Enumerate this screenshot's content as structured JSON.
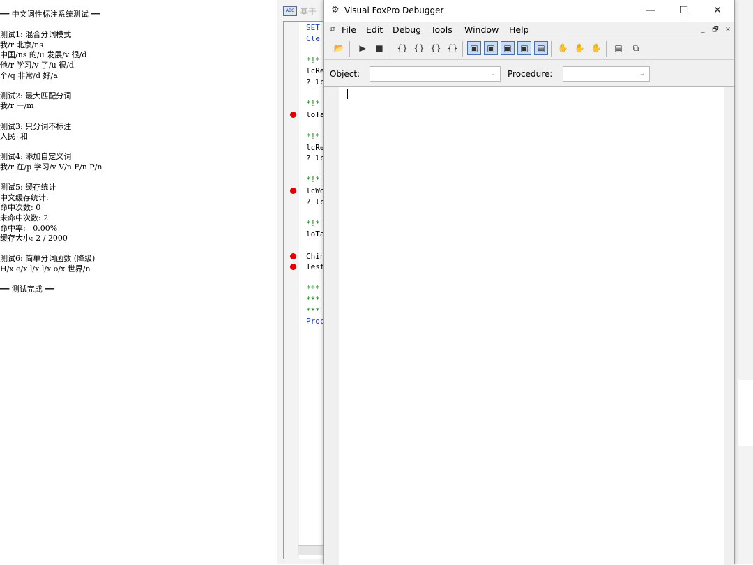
{
  "console": {
    "lines": [
      "══ 中文词性标注系统测试 ══",
      "",
      "测试1: 混合分词模式",
      "我/r 北京/ns",
      "中国/ns 的/u 发展/v 很/d",
      "他/r 学习/v 了/u 很/d",
      "个/q 非常/d 好/a",
      "",
      "测试2: 最大匹配分词",
      "我/r 一/m",
      "",
      "测试3: 只分词不标注",
      "人民  和",
      "",
      "测试4: 添加自定义词",
      "我/r 在/p 学习/v V/n F/n P/n",
      "",
      "测试5: 缓存统计",
      "中文缓存统计:",
      "命中次数: 0",
      "未命中次数: 2",
      "命中率:   0.00%",
      "缓存大小: 2 / 2000",
      "",
      "测试6: 简单分词函数 (降级)",
      "H/x e/x l/x l/x o/x 世界/n",
      "",
      "══ 测试完成 ══"
    ]
  },
  "editor": {
    "icon_text": "ABC",
    "title": "基于",
    "code_lines": [
      {
        "text": "SET",
        "color": "#1a3fbf",
        "bp": false
      },
      {
        "text": "Cle",
        "color": "#1a3fbf",
        "bp": false
      },
      {
        "text": "",
        "color": "#000000",
        "bp": false
      },
      {
        "text": "*!*",
        "color": "#1f8a1f",
        "bp": false
      },
      {
        "text": "lcRe",
        "color": "#000000",
        "bp": false
      },
      {
        "text": "? lc",
        "color": "#000000",
        "bp": false
      },
      {
        "text": "",
        "color": "#000000",
        "bp": false
      },
      {
        "text": "*!*",
        "color": "#1f8a1f",
        "bp": false
      },
      {
        "text": "loTa",
        "color": "#000000",
        "bp": true
      },
      {
        "text": "",
        "color": "#000000",
        "bp": false
      },
      {
        "text": "*!*",
        "color": "#1f8a1f",
        "bp": false
      },
      {
        "text": "lcRe",
        "color": "#000000",
        "bp": false
      },
      {
        "text": "? lc",
        "color": "#000000",
        "bp": false
      },
      {
        "text": "",
        "color": "#000000",
        "bp": false
      },
      {
        "text": "*!*",
        "color": "#1f8a1f",
        "bp": false
      },
      {
        "text": "lcWo",
        "color": "#000000",
        "bp": true
      },
      {
        "text": "? lc",
        "color": "#000000",
        "bp": false
      },
      {
        "text": "",
        "color": "#000000",
        "bp": false
      },
      {
        "text": "*!*",
        "color": "#1f8a1f",
        "bp": false
      },
      {
        "text": "loTa",
        "color": "#000000",
        "bp": false
      },
      {
        "text": "",
        "color": "#000000",
        "bp": false
      },
      {
        "text": "Chin",
        "color": "#000000",
        "bp": true
      },
      {
        "text": "Test",
        "color": "#000000",
        "bp": true
      },
      {
        "text": "",
        "color": "#000000",
        "bp": false
      },
      {
        "text": "***",
        "color": "#1f8a1f",
        "bp": false
      },
      {
        "text": "***",
        "color": "#1f8a1f",
        "bp": false
      },
      {
        "text": "***",
        "color": "#1f8a1f",
        "bp": false
      },
      {
        "text": "Proc",
        "color": "#1a3fbf",
        "bp": false
      }
    ]
  },
  "debugger": {
    "title": "Visual FoxPro Debugger",
    "app_icon": "bug-icon",
    "caption": {
      "minimize": "—",
      "maximize": "☐",
      "close": "✕"
    },
    "menu": [
      "File",
      "Edit",
      "Debug",
      "Tools",
      "Window",
      "Help"
    ],
    "menu_icon": "debugger-menu-icon",
    "mdi": {
      "minimize": "_",
      "restore": "🗗",
      "close": "×"
    },
    "toolbar": [
      {
        "name": "open-icon",
        "glyph": "📂",
        "boxed": false
      },
      {
        "name": "resume-icon",
        "glyph": "▶",
        "boxed": false
      },
      {
        "name": "cancel-icon",
        "glyph": "■",
        "boxed": false
      },
      {
        "name": "step-into-icon",
        "glyph": "{}",
        "boxed": false
      },
      {
        "name": "step-over-icon",
        "glyph": "{}",
        "boxed": false
      },
      {
        "name": "step-out-icon",
        "glyph": "{}",
        "boxed": false
      },
      {
        "name": "run-to-cursor-icon",
        "glyph": "{}",
        "boxed": false
      },
      {
        "name": "trace-window-icon",
        "glyph": "▣",
        "boxed": true
      },
      {
        "name": "watch-window-icon",
        "glyph": "▣",
        "boxed": true
      },
      {
        "name": "locals-window-icon",
        "glyph": "▣",
        "boxed": true
      },
      {
        "name": "call-stack-window-icon",
        "glyph": "▣",
        "boxed": true
      },
      {
        "name": "output-window-icon",
        "glyph": "▤",
        "boxed": true
      },
      {
        "name": "toggle-breakpoint-icon",
        "glyph": "✋",
        "boxed": false
      },
      {
        "name": "clear-breakpoints-icon",
        "glyph": "✋",
        "boxed": false
      },
      {
        "name": "breakpoints-dialog-icon",
        "glyph": "✋",
        "boxed": false
      },
      {
        "name": "toggle-logging-icon",
        "glyph": "▤",
        "boxed": false
      },
      {
        "name": "coverage-icon",
        "glyph": "⧉",
        "boxed": false
      }
    ],
    "object_label": "Object:",
    "object_value": "",
    "procedure_label": "Procedure:",
    "procedure_value": ""
  }
}
